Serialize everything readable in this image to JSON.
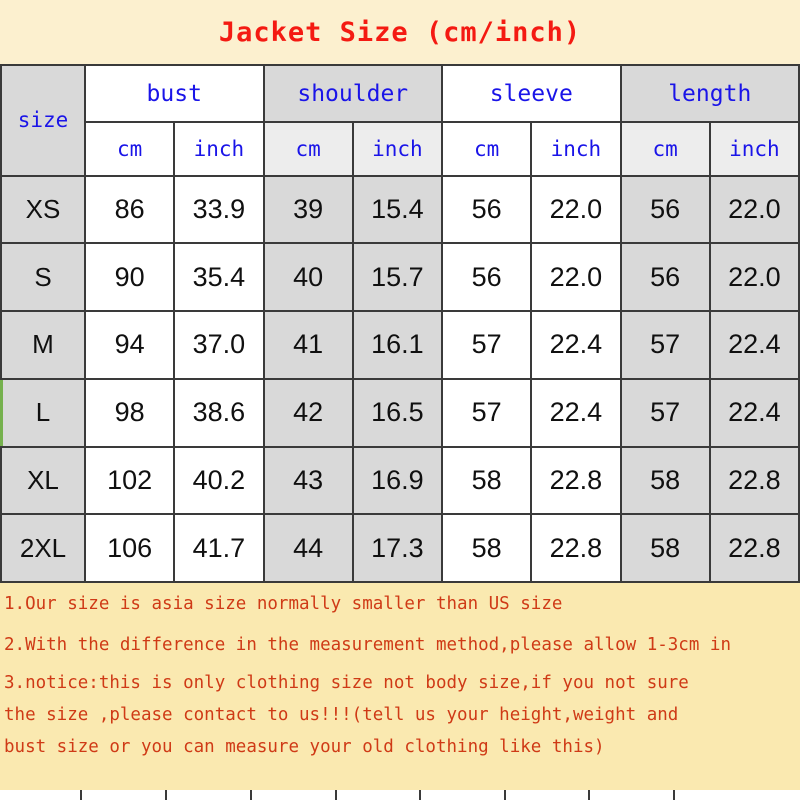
{
  "title": "Jacket Size (cm/inch)",
  "colors": {
    "title_red": "#f41a12",
    "header_blue": "#1a14e8",
    "note_red": "#cf3a16",
    "band_cream": "#fcf0cf",
    "notes_cream": "#fae9b0",
    "cell_gray": "#d9d9d9",
    "grid_line": "#3a3a3a"
  },
  "table": {
    "size_header": "size",
    "groups": [
      {
        "label": "bust",
        "shade": "white"
      },
      {
        "label": "shoulder",
        "shade": "gray"
      },
      {
        "label": "sleeve",
        "shade": "white"
      },
      {
        "label": "length",
        "shade": "gray"
      }
    ],
    "sub_headers": [
      "cm",
      "inch",
      "cm",
      "inch",
      "cm",
      "inch",
      "cm",
      "inch"
    ],
    "rows": [
      {
        "size": "XS",
        "bust_cm": "86",
        "bust_inch": "33.9",
        "shoulder_cm": "39",
        "shoulder_inch": "15.4",
        "sleeve_cm": "56",
        "sleeve_inch": "22.0",
        "length_cm": "56",
        "length_inch": "22.0"
      },
      {
        "size": "S",
        "bust_cm": "90",
        "bust_inch": "35.4",
        "shoulder_cm": "40",
        "shoulder_inch": "15.7",
        "sleeve_cm": "56",
        "sleeve_inch": "22.0",
        "length_cm": "56",
        "length_inch": "22.0"
      },
      {
        "size": "M",
        "bust_cm": "94",
        "bust_inch": "37.0",
        "shoulder_cm": "41",
        "shoulder_inch": "16.1",
        "sleeve_cm": "57",
        "sleeve_inch": "22.4",
        "length_cm": "57",
        "length_inch": "22.4"
      },
      {
        "size": "L",
        "bust_cm": "98",
        "bust_inch": "38.6",
        "shoulder_cm": "42",
        "shoulder_inch": "16.5",
        "sleeve_cm": "57",
        "sleeve_inch": "22.4",
        "length_cm": "57",
        "length_inch": "22.4"
      },
      {
        "size": "XL",
        "bust_cm": "102",
        "bust_inch": "40.2",
        "shoulder_cm": "43",
        "shoulder_inch": "16.9",
        "sleeve_cm": "58",
        "sleeve_inch": "22.8",
        "length_cm": "58",
        "length_inch": "22.8"
      },
      {
        "size": "2XL",
        "bust_cm": "106",
        "bust_inch": "41.7",
        "shoulder_cm": "44",
        "shoulder_inch": "17.3",
        "sleeve_cm": "58",
        "sleeve_inch": "22.8",
        "length_cm": "58",
        "length_inch": "22.8"
      }
    ]
  },
  "notes": {
    "note1": "1.Our size is asia size normally smaller than US size",
    "note2": "2.With the difference in the measurement method,please allow 1-3cm in",
    "note3_line1": "3.notice:this is only clothing size not body size,if you not sure",
    "note3_line2": "the size ,please contact to us!!!(tell us your height,weight and",
    "note3_line3": "bust size or you can measure your old clothing like this)"
  }
}
